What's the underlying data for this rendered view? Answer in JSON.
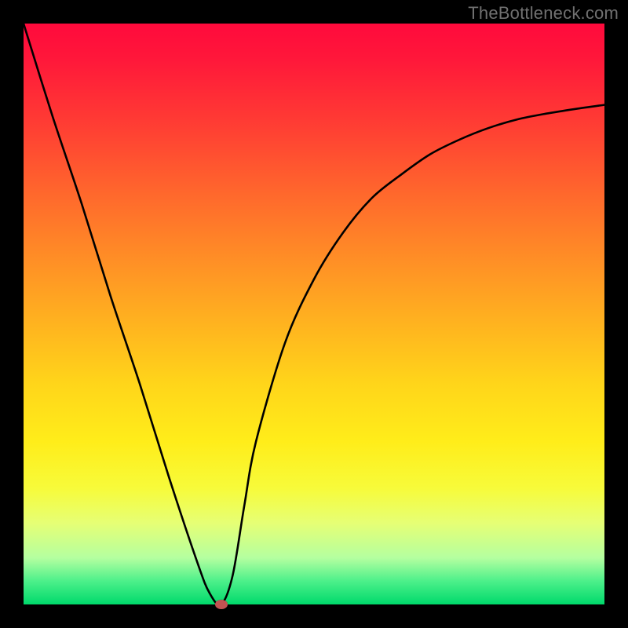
{
  "watermark": "TheBottleneck.com",
  "chart_data": {
    "type": "line",
    "title": "",
    "xlabel": "",
    "ylabel": "",
    "xlim": [
      0,
      100
    ],
    "ylim": [
      0,
      100
    ],
    "grid": false,
    "legend": false,
    "background_gradient": [
      "#ff0a3c",
      "#ffed1a",
      "#00d96b"
    ],
    "series": [
      {
        "name": "bottleneck-curve",
        "color": "#000000",
        "x": [
          0,
          5,
          10,
          15,
          20,
          25,
          30,
          32,
          34,
          36,
          38,
          40,
          45,
          50,
          55,
          60,
          65,
          70,
          75,
          80,
          85,
          90,
          95,
          100
        ],
        "values": [
          100,
          84,
          69,
          53,
          38,
          22,
          7,
          2,
          0,
          5,
          17,
          28,
          45,
          56,
          64,
          70,
          74,
          77.5,
          80,
          82,
          83.5,
          84.5,
          85.3,
          86
        ]
      }
    ],
    "marker": {
      "x": 34,
      "y": 0,
      "color": "#c15252"
    }
  }
}
